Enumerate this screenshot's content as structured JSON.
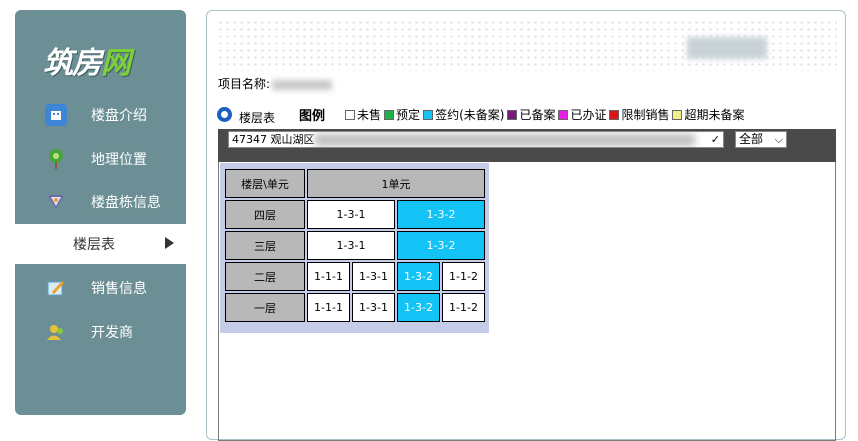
{
  "sidebar": {
    "logo_part1": "筑房",
    "logo_part2": "网",
    "items": [
      {
        "label": "楼盘介绍",
        "icon": "building-info-icon",
        "color": "#3d86d6"
      },
      {
        "label": "地理位置",
        "icon": "map-pin-icon",
        "color": "#4aa33a"
      },
      {
        "label": "楼盘栋信息",
        "icon": "building-list-icon",
        "color": "#6e6aa8"
      },
      {
        "label": "楼层表",
        "icon": "",
        "active": true
      },
      {
        "label": "销售信息",
        "icon": "edit-pencil-icon",
        "color": "#5fa0c9"
      },
      {
        "label": "开发商",
        "icon": "developer-user-icon",
        "color": "#e6c23a"
      }
    ]
  },
  "project": {
    "label": "项目名称:"
  },
  "view": {
    "radio_label": "楼层表"
  },
  "legend": {
    "title": "图例",
    "items": [
      {
        "label": "未售",
        "color": "#ffffff"
      },
      {
        "label": "预定",
        "color": "#1fb24a"
      },
      {
        "label": "签约(未备案)",
        "color": "#14c3f6"
      },
      {
        "label": "已备案",
        "color": "#7a1a7a"
      },
      {
        "label": "已办证",
        "color": "#e61ee6"
      },
      {
        "label": "限制销售",
        "color": "#e01414"
      },
      {
        "label": "超期未备案",
        "color": "#f2f08a"
      }
    ]
  },
  "building_select": {
    "value": "47347 观山湖区"
  },
  "unit_select": {
    "value": "全部"
  },
  "table": {
    "header_floor_unit": "楼层\\单元",
    "unit_name": "1单元",
    "floors": [
      {
        "name": "四层",
        "rooms": [
          {
            "no": "1-3-1",
            "status": "unsold"
          },
          {
            "no": "1-3-2",
            "status": "signed"
          }
        ]
      },
      {
        "name": "三层",
        "rooms": [
          {
            "no": "1-3-1",
            "status": "unsold"
          },
          {
            "no": "1-3-2",
            "status": "signed"
          }
        ]
      },
      {
        "name": "二层",
        "rooms": [
          {
            "no": "1-1-1",
            "status": "unsold"
          },
          {
            "no": "1-3-1",
            "status": "unsold"
          },
          {
            "no": "1-3-2",
            "status": "signed"
          },
          {
            "no": "1-1-2",
            "status": "unsold"
          }
        ]
      },
      {
        "name": "一层",
        "rooms": [
          {
            "no": "1-1-1",
            "status": "unsold"
          },
          {
            "no": "1-3-1",
            "status": "unsold"
          },
          {
            "no": "1-3-2",
            "status": "signed"
          },
          {
            "no": "1-1-2",
            "status": "unsold"
          }
        ]
      }
    ]
  }
}
